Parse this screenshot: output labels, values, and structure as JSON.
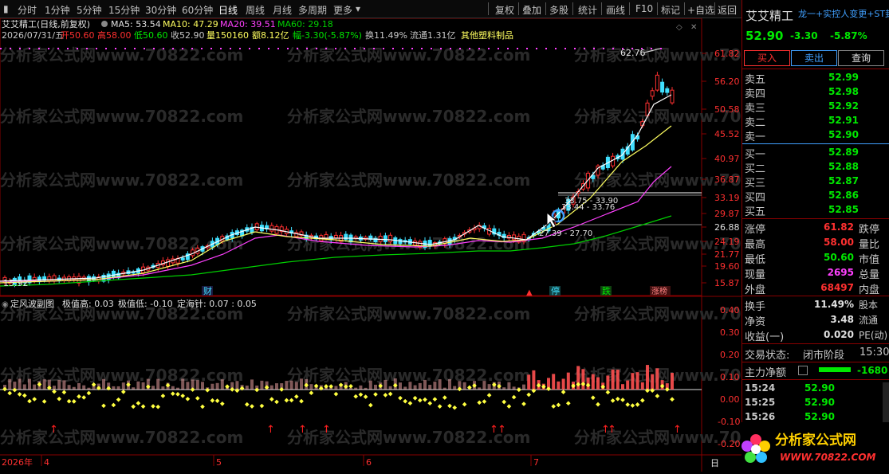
{
  "toolbar": {
    "items": [
      "分时",
      "1分钟",
      "5分钟",
      "15分钟",
      "30分钟",
      "60分钟",
      "日线",
      "周线",
      "月线",
      "多周期",
      "更多"
    ],
    "right_items": [
      "复权",
      "叠加",
      "多股",
      "统计",
      "画线",
      "F10",
      "标记",
      "+自选",
      "返回"
    ]
  },
  "header": {
    "stock_title": "艾艾精工(日线,前复权)",
    "ma5": "MA5: 53.54",
    "ma10": "MA10: 47.29",
    "ma20": "MA20: 39.51",
    "ma60": "MA60: 29.18",
    "date": "2026/07/31/五",
    "open": "开50.60",
    "high": "高58.00",
    "low": "低50.60",
    "close": "收52.90",
    "volume": "量150160",
    "amount": "额8.12亿",
    "change": "幅-3.30(-5.87%)",
    "turnover": "换11.49%",
    "float": "流通1.31亿",
    "sector": "其他塑料制品"
  },
  "price_axis": [
    "61.82",
    "56.20",
    "50.58",
    "45.52",
    "40.97",
    "36.87",
    "33.19",
    "29.87",
    "26.88",
    "24.19",
    "21.77",
    "19.60",
    "15.87"
  ],
  "annotations": {
    "peak": "62.76",
    "low_label": "15.92",
    "line1": "33.75 - 33.90",
    "line2": "33.44 - 33.76",
    "line3": "27.39 - 27.70",
    "marker_cai": "财",
    "marker_ting": "停",
    "marker_die": "跌",
    "marker_zhang": "涨榜"
  },
  "indicator": {
    "title": "定风波副图",
    "max_label": "极值高: 0.03",
    "min_label": "极值低: -0.10",
    "needle_label": "定海针: 0.07 : 0.05",
    "axis": [
      "0.40",
      "0.30",
      "0.20",
      "0.10",
      "0.00",
      "-0.10",
      "-0.20"
    ]
  },
  "time_axis": {
    "labels": [
      "2026年",
      "4",
      "5",
      "6",
      "7"
    ],
    "corner": "日"
  },
  "watermark": "分析家公式网www.70822.com",
  "right_panel": {
    "name": "艾艾精工",
    "ticker_info": "龙一+实控人变更+ST封",
    "price": "52.90",
    "change": "-3.30",
    "pct": "-5.87%",
    "buy_btn": "买入",
    "sell_btn": "卖出",
    "query_btn": "查询",
    "asks": [
      {
        "label": "卖五",
        "price": "52.99"
      },
      {
        "label": "卖四",
        "price": "52.98"
      },
      {
        "label": "卖三",
        "price": "52.92"
      },
      {
        "label": "卖二",
        "price": "52.91"
      },
      {
        "label": "卖一",
        "price": "52.90"
      }
    ],
    "bids": [
      {
        "label": "买一",
        "price": "52.89"
      },
      {
        "label": "买二",
        "price": "52.88"
      },
      {
        "label": "买三",
        "price": "52.87"
      },
      {
        "label": "买四",
        "price": "52.86"
      },
      {
        "label": "买五",
        "price": "52.85"
      }
    ],
    "stats": [
      {
        "l1": "涨停",
        "v1": "61.82",
        "c1": "red",
        "l2": "跌停"
      },
      {
        "l1": "最高",
        "v1": "58.00",
        "c1": "red",
        "l2": "量比"
      },
      {
        "l1": "最低",
        "v1": "50.60",
        "c1": "green",
        "l2": "市值"
      },
      {
        "l1": "现量",
        "v1": "2695",
        "c1": "magenta",
        "l2": "总量"
      },
      {
        "l1": "外盘",
        "v1": "68497",
        "c1": "red",
        "l2": "内盘"
      }
    ],
    "stats2": [
      {
        "l1": "换手",
        "v1": "11.49%",
        "l2": "股本"
      },
      {
        "l1": "净资",
        "v1": "3.48",
        "l2": "流通"
      },
      {
        "l1": "收益(一)",
        "v1": "0.020",
        "l2": "PE(动)"
      }
    ],
    "trade_state_label": "交易状态:",
    "trade_state": "闭市阶段",
    "trade_time": "15:30",
    "main_flow_label": "主力净额",
    "main_flow_value": "-1680",
    "ticks": [
      {
        "time": "15:24",
        "price": "52.90"
      },
      {
        "time": "15:25",
        "price": "52.90"
      },
      {
        "time": "15:26",
        "price": "52.90"
      }
    ],
    "logo_text": "分析家公式网",
    "logo_url": "WWW.70822.COM"
  },
  "colors": {
    "up": "#ff3030",
    "down": "#00e8ff",
    "ma5": "#ffffff",
    "ma10": "#ffff60",
    "ma20": "#ff40ff",
    "ma60": "#00d000",
    "grid": "#880000"
  }
}
